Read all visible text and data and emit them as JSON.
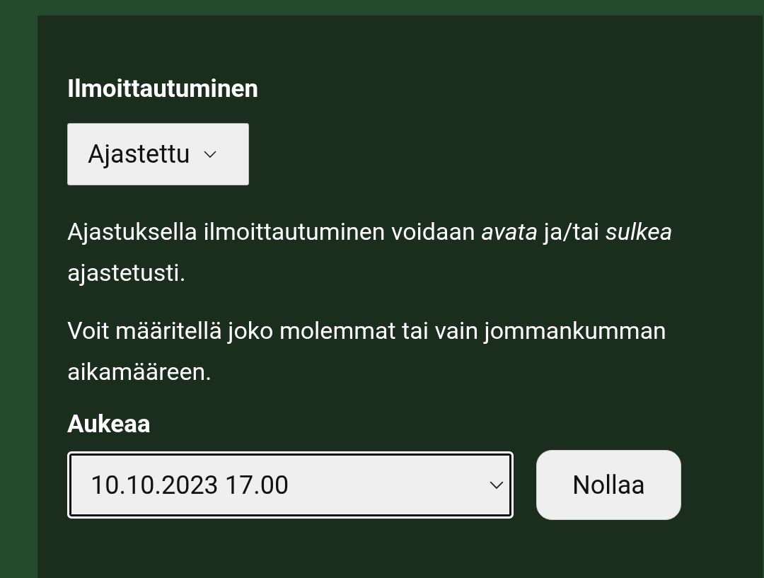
{
  "registration": {
    "heading": "Ilmoittautuminen",
    "mode_select": {
      "value": "Ajastettu"
    },
    "paragraphs": [
      "Ajastuksella ilmoittautuminen voidaan *avata* ja/tai *sulkea* ajastetusti.",
      "Voit määritellä joko molemmat tai vain jommankumman aikamääreen."
    ],
    "opens": {
      "label": "Aukeaa",
      "datetime_field": {
        "value": "10.10.2023 17.00",
        "focused": true
      },
      "reset_button": "Nollaa"
    }
  }
}
